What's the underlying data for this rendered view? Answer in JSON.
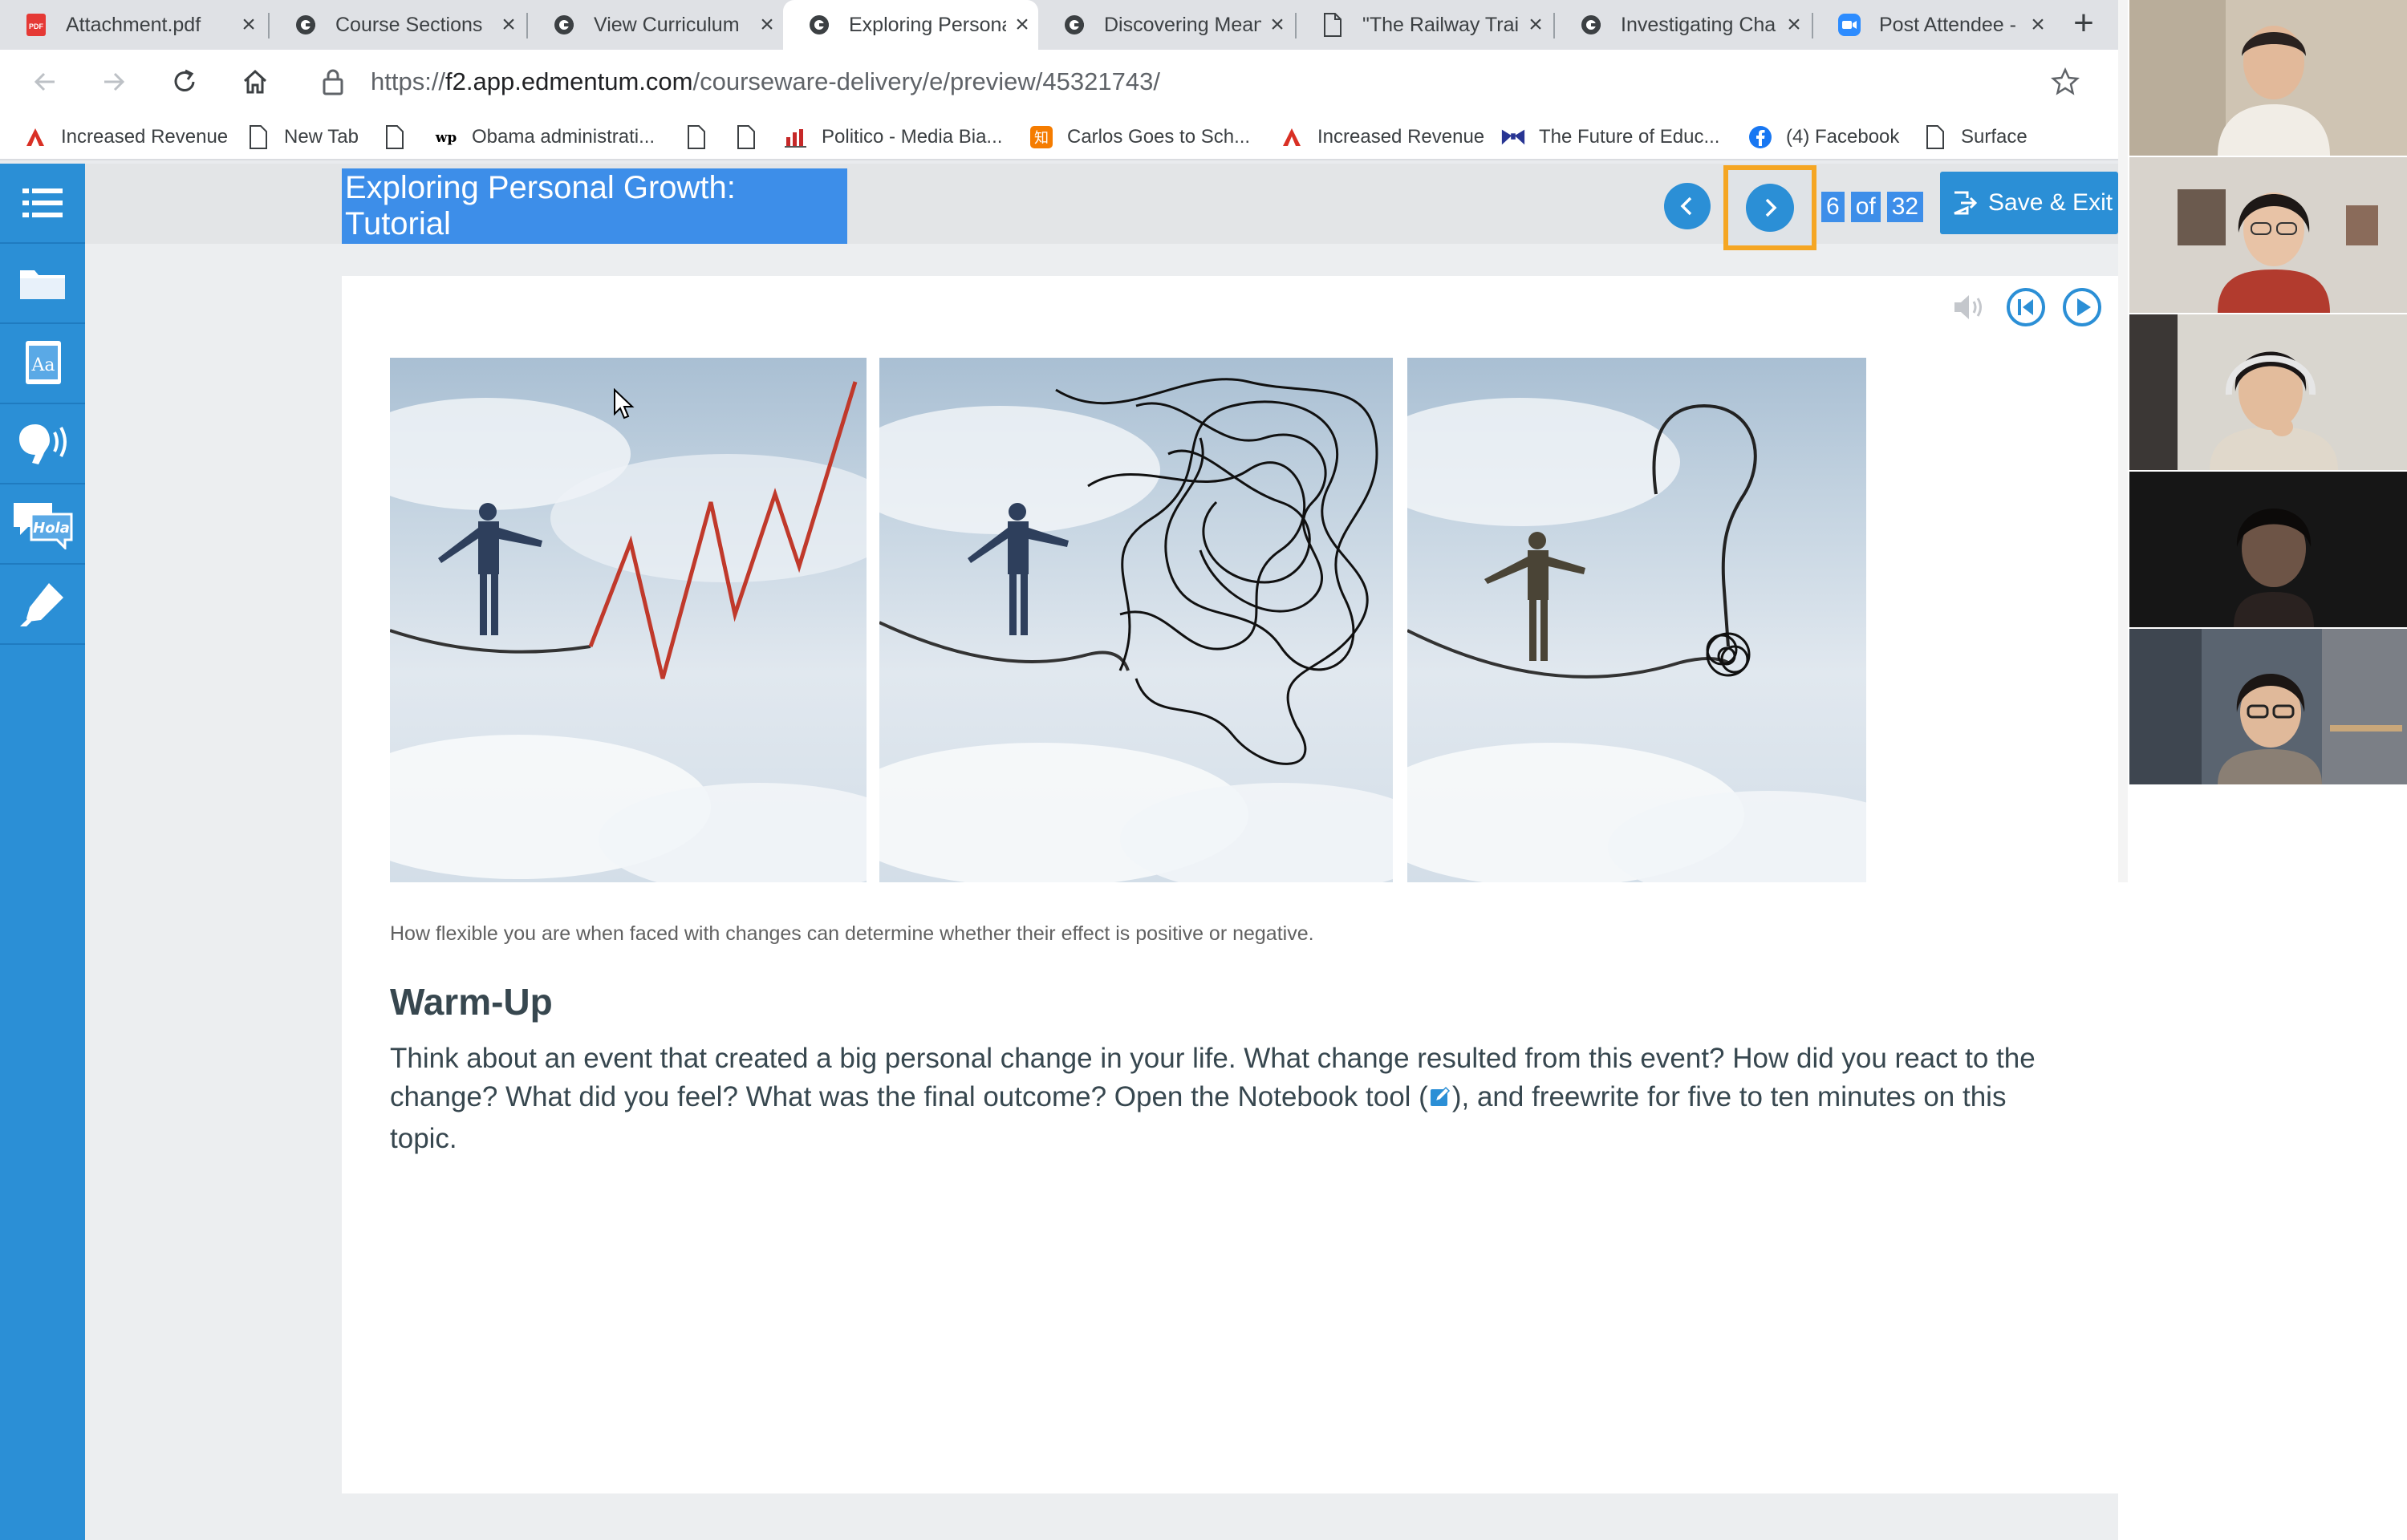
{
  "browser": {
    "tabs": [
      {
        "title": "Attachment.pdf",
        "favicon": "pdf-icon"
      },
      {
        "title": "Course Sections",
        "favicon": "edmentum-icon"
      },
      {
        "title": "View Curriculum",
        "favicon": "edmentum-icon"
      },
      {
        "title": "Exploring Persona",
        "favicon": "edmentum-icon",
        "active": true
      },
      {
        "title": "Discovering Mean",
        "favicon": "edmentum-icon"
      },
      {
        "title": "\"The Railway Trai",
        "favicon": "page-icon"
      },
      {
        "title": "Investigating Cha",
        "favicon": "edmentum-icon"
      },
      {
        "title": "Post Attendee - Z",
        "favicon": "zoom-icon"
      }
    ],
    "url_prefix": "https://",
    "url_host": "f2.app.edmentum.com",
    "url_path": "/courseware-delivery/e/preview/45321743/",
    "bookmarks": [
      {
        "label": "Increased Revenue",
        "icon": "adobe-icon"
      },
      {
        "label": "New Tab",
        "icon": "page-icon"
      },
      {
        "label": "",
        "icon": "page-icon"
      },
      {
        "label": "Obama administrati...",
        "icon": "wp-icon"
      },
      {
        "label": "",
        "icon": "page-icon"
      },
      {
        "label": "",
        "icon": "page-icon"
      },
      {
        "label": "Politico - Media Bia...",
        "icon": "chart-icon"
      },
      {
        "label": "Carlos Goes to Sch...",
        "icon": "zhihu-icon"
      },
      {
        "label": "Increased Revenue",
        "icon": "adobe-icon"
      },
      {
        "label": "The Future of Educ...",
        "icon": "bowtie-icon"
      },
      {
        "label": "(4) Facebook",
        "icon": "facebook-icon"
      },
      {
        "label": "Surface",
        "icon": "page-icon"
      }
    ]
  },
  "lesson": {
    "title": "Exploring Personal Growth: Tutorial",
    "page_current": "6",
    "page_of": "of",
    "page_total": "32",
    "save_exit_label": "Save & Exit",
    "caption": "How flexible you are when faced with changes can determine whether their effect is positive or negative.",
    "heading": "Warm-Up",
    "body_before_icon": "Think about an event that created a big personal change in your life. What change resulted from this event? How did you react to the change? What did you feel? What was the final outcome? Open the Notebook tool (",
    "body_after_icon": "), and freewrite for five to ten minutes on this topic."
  },
  "sidebar_tools": [
    "list-icon",
    "folder-icon",
    "dictionary-icon",
    "speech-icon",
    "translate-icon",
    "highlighter-icon"
  ],
  "sidebar_translate_label": "Hola",
  "colors": {
    "accent": "#2b8fd6",
    "title_highlight": "#3d8ee9",
    "focus_ring": "#f5a623"
  }
}
